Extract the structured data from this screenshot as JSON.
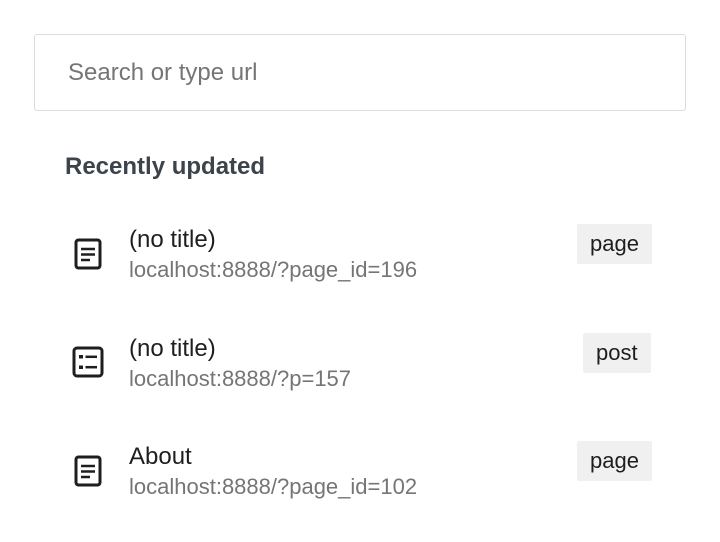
{
  "search": {
    "placeholder": "Search or type url",
    "value": ""
  },
  "section": {
    "title": "Recently updated"
  },
  "items": [
    {
      "title": "(no title)",
      "url": "localhost:8888/?page_id=196",
      "type": "page",
      "icon": "page-icon"
    },
    {
      "title": "(no title)",
      "url": "localhost:8888/?p=157",
      "type": "post",
      "icon": "post-list-icon"
    },
    {
      "title": "About",
      "url": "localhost:8888/?page_id=102",
      "type": "page",
      "icon": "page-icon"
    }
  ],
  "colors": {
    "border": "#dcdcde",
    "heading": "#3c434a",
    "text": "#1e1e1e",
    "muted": "#757575",
    "badge_bg": "#f0f0f0"
  }
}
